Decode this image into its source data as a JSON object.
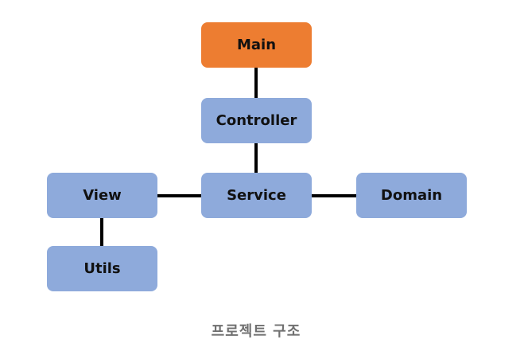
{
  "diagram": {
    "nodes": {
      "main": "Main",
      "controller": "Controller",
      "view": "View",
      "service": "Service",
      "domain": "Domain",
      "utils": "Utils"
    },
    "colors": {
      "main_fill": "#ED7D31",
      "node_fill": "#8EAADB",
      "connector": "#000000",
      "caption_text": "#707070"
    },
    "edges": [
      [
        "Main",
        "Controller"
      ],
      [
        "Controller",
        "Service"
      ],
      [
        "View",
        "Service"
      ],
      [
        "Service",
        "Domain"
      ],
      [
        "View",
        "Utils"
      ]
    ],
    "caption": "프로젝트 구조"
  }
}
